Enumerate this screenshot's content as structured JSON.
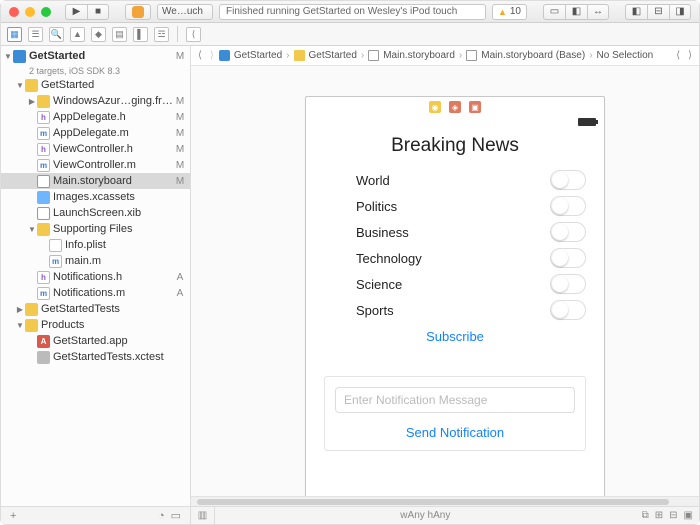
{
  "toolbar": {
    "scheme_icon_label": "A",
    "tab_label": "We…uch",
    "status_text": "Finished running GetStarted on Wesley's iPod touch",
    "warning_count": "10"
  },
  "breadcrumb": {
    "items": [
      "GetStarted",
      "GetStarted",
      "Main.storyboard",
      "Main.storyboard (Base)",
      "No Selection"
    ]
  },
  "project": {
    "name": "GetStarted",
    "subtitle": "2 targets, iOS SDK 8.3",
    "status": "M"
  },
  "tree": [
    {
      "d": 1,
      "open": true,
      "type": "fold",
      "name": "GetStarted",
      "st": ""
    },
    {
      "d": 2,
      "open": false,
      "type": "fw",
      "name": "WindowsAzur…ging.framework",
      "st": "M"
    },
    {
      "d": 2,
      "type": "h",
      "name": "AppDelegate.h",
      "st": "M"
    },
    {
      "d": 2,
      "type": "m",
      "name": "AppDelegate.m",
      "st": "M"
    },
    {
      "d": 2,
      "type": "h",
      "name": "ViewController.h",
      "st": "M"
    },
    {
      "d": 2,
      "type": "m",
      "name": "ViewController.m",
      "st": "M"
    },
    {
      "d": 2,
      "type": "sb",
      "name": "Main.storyboard",
      "st": "M",
      "sel": true
    },
    {
      "d": 2,
      "type": "img",
      "name": "Images.xcassets",
      "st": ""
    },
    {
      "d": 2,
      "type": "xib",
      "name": "LaunchScreen.xib",
      "st": ""
    },
    {
      "d": 2,
      "open": true,
      "type": "fold",
      "name": "Supporting Files",
      "st": ""
    },
    {
      "d": 3,
      "type": "plist",
      "name": "Info.plist",
      "st": ""
    },
    {
      "d": 3,
      "type": "m",
      "name": "main.m",
      "st": ""
    },
    {
      "d": 2,
      "type": "h",
      "name": "Notifications.h",
      "st": "A"
    },
    {
      "d": 2,
      "type": "m",
      "name": "Notifications.m",
      "st": "A"
    },
    {
      "d": 1,
      "open": false,
      "type": "fold",
      "name": "GetStartedTests",
      "st": ""
    },
    {
      "d": 1,
      "open": true,
      "type": "fold",
      "name": "Products",
      "st": ""
    },
    {
      "d": 2,
      "type": "app",
      "name": "GetStarted.app",
      "st": ""
    },
    {
      "d": 2,
      "type": "test",
      "name": "GetStartedTests.xctest",
      "st": ""
    }
  ],
  "canvas": {
    "heading": "Breaking News",
    "options": [
      "World",
      "Politics",
      "Business",
      "Technology",
      "Science",
      "Sports"
    ],
    "subscribe": "Subscribe",
    "msg_placeholder": "Enter Notification Message",
    "send": "Send Notification"
  },
  "bottom": {
    "size_class": "wAny hAny"
  }
}
